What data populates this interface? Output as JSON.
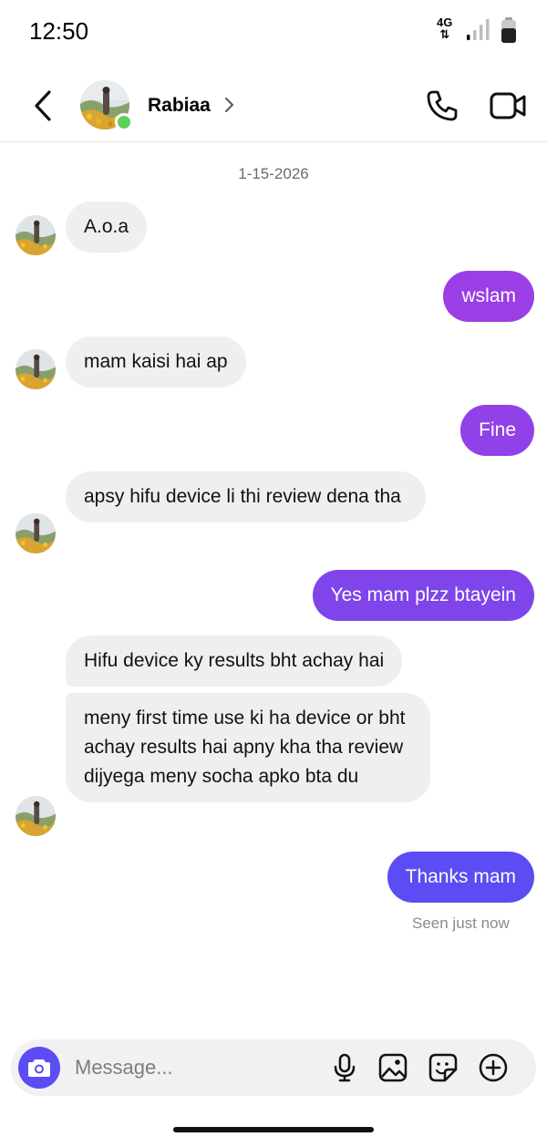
{
  "status_bar": {
    "time": "12:50",
    "network_top": "4G",
    "network_bottom": "⇅",
    "icons": [
      "signal-icon",
      "battery-icon"
    ]
  },
  "header": {
    "contact_name": "Rabiaa",
    "online": true,
    "icons": [
      "back-arrow-icon",
      "chevron-right-icon",
      "phone-icon",
      "video-camera-icon"
    ]
  },
  "conversation": {
    "date": "1-15-2026",
    "messages": [
      {
        "sender": "them",
        "text": "A.o.a"
      },
      {
        "sender": "me",
        "text": "wslam"
      },
      {
        "sender": "them",
        "text": "mam kaisi hai ap"
      },
      {
        "sender": "me",
        "text": "Fine"
      },
      {
        "sender": "them",
        "text": "apsy hifu device li thi review dena tha"
      },
      {
        "sender": "me",
        "text": "Yes mam plzz btayein"
      },
      {
        "sender": "them",
        "text": "Hifu device ky results bht achay hai"
      },
      {
        "sender": "them",
        "text": "meny first time use ki ha device or bht achay results hai apny kha tha review dijyega meny socha apko bta du"
      },
      {
        "sender": "me",
        "text": "Thanks mam"
      }
    ],
    "seen_status": "Seen just now"
  },
  "composer": {
    "placeholder": "Message...",
    "icons": [
      "camera-icon",
      "microphone-icon",
      "gallery-icon",
      "sticker-icon",
      "add-icon"
    ]
  },
  "colors": {
    "incoming_bubble": "#efeff0",
    "outgoing_top": "#9b3ee6",
    "outgoing_mid": "#7f45ea",
    "outgoing_bottom": "#5b4cf3",
    "camera_button": "#5b4cf3",
    "online_dot": "#5cd05a"
  }
}
